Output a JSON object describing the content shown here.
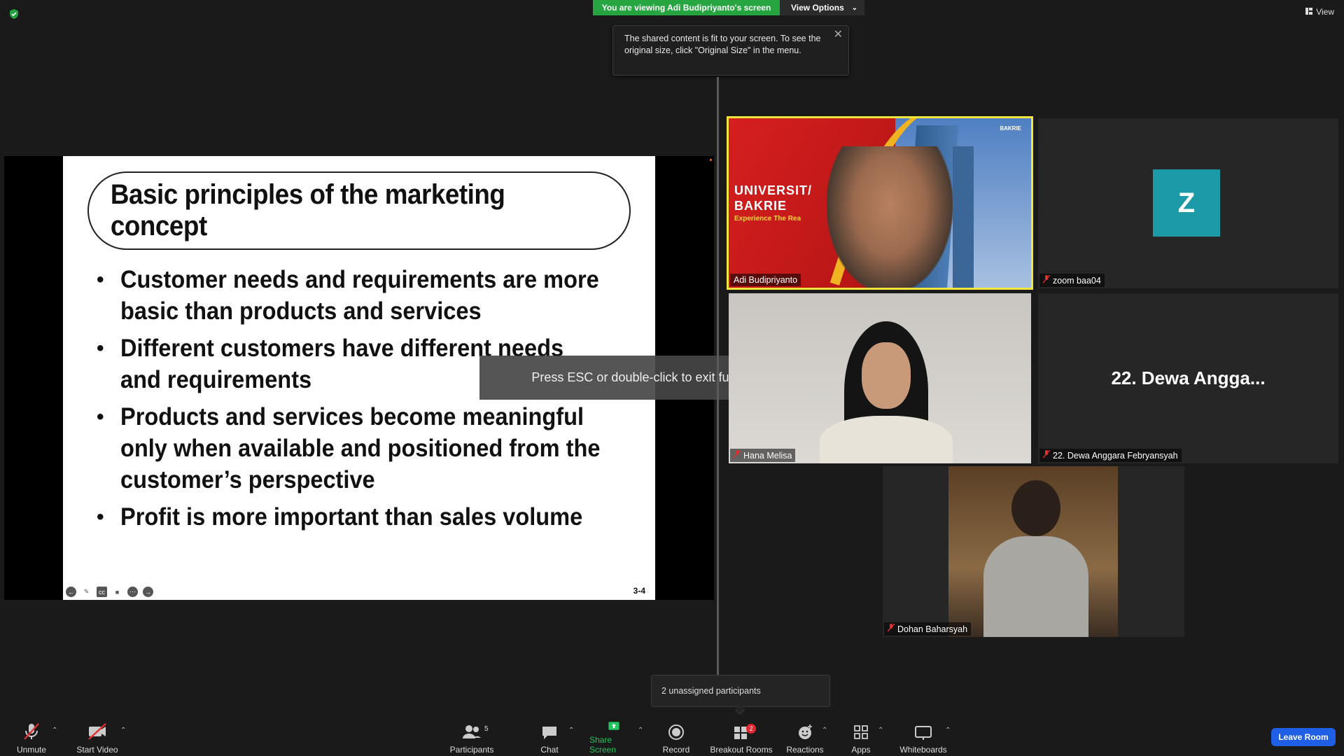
{
  "top": {
    "viewing_banner": "You are viewing Adi Budipriyanto's screen",
    "view_options": "View Options",
    "view_label": "View"
  },
  "tooltip": {
    "text": "The shared content is fit to your screen. To see the original size, click \"Original Size\" in the menu."
  },
  "slide": {
    "title": "Basic principles of the marketing concept",
    "bullets": [
      "Customer needs and requirements are more basic than products and services",
      "Different customers have different needs and requirements",
      "Products and services become meaningful only when available and positioned from the customer’s perspective",
      "Profit is more important than sales volume"
    ],
    "page_number": "3-4"
  },
  "fullscreen_message": "Press ESC or double-click to exit full screen mode",
  "participants": [
    {
      "name": "Adi Budipriyanto",
      "muted": false,
      "active_speaker": true
    },
    {
      "name": "zoom baa04",
      "muted": true,
      "avatar_letter": "Z",
      "avatar_color": "#1c9aa8"
    },
    {
      "name": "Hana Melisa",
      "muted": true
    },
    {
      "name": "22. Dewa Anggara Febryansyah",
      "muted": true,
      "display_short": "22. Dewa Angga..."
    },
    {
      "name": "Dohan Baharsyah",
      "muted": true
    }
  ],
  "adi_background": {
    "univ_line1": "UNIVERSIT/",
    "univ_line2": "BAKRIE",
    "tagline": "Experience The Rea",
    "logo_text": "BAKRIE"
  },
  "popup": {
    "unassigned": "2 unassigned participants"
  },
  "toolbar": {
    "unmute": "Unmute",
    "start_video": "Start Video",
    "participants": "Participants",
    "participants_count": "5",
    "chat": "Chat",
    "share_screen": "Share Screen",
    "record": "Record",
    "breakout_rooms": "Breakout Rooms",
    "breakout_badge": "2",
    "reactions": "Reactions",
    "apps": "Apps",
    "whiteboards": "Whiteboards",
    "leave": "Leave Room"
  },
  "colors": {
    "banner_green": "#26a541",
    "active_speaker_border": "#f4e53c",
    "leave_blue": "#1e5fe6",
    "share_green": "#22c55e"
  }
}
